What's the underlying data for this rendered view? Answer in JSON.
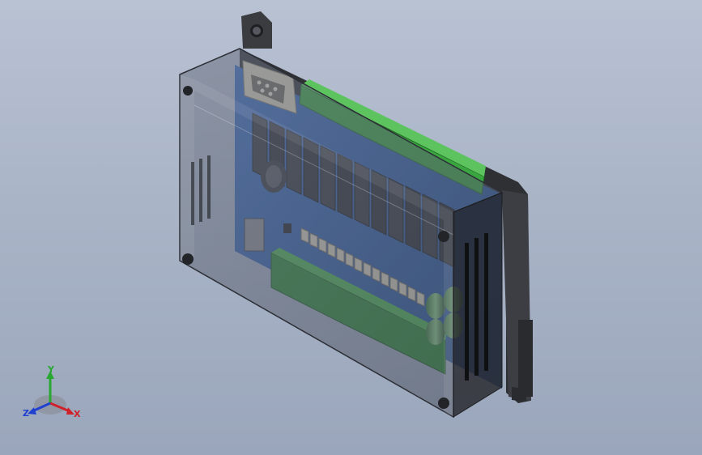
{
  "viewport": {
    "background_color": "#a9b4c7"
  },
  "model": {
    "description_icon": "plc-controller-model",
    "housing_color": "#3a3c40",
    "pcb_color": "#2f5fb0",
    "terminal_color": "#2f9a3a",
    "relay_color": "#2a2a2e",
    "connector_color": "#c8c0a8"
  },
  "triad": {
    "x_label": "X",
    "y_label": "Y",
    "z_label": "Z",
    "x_color": "#d0202a",
    "y_color": "#28a830",
    "z_color": "#2040d0"
  }
}
